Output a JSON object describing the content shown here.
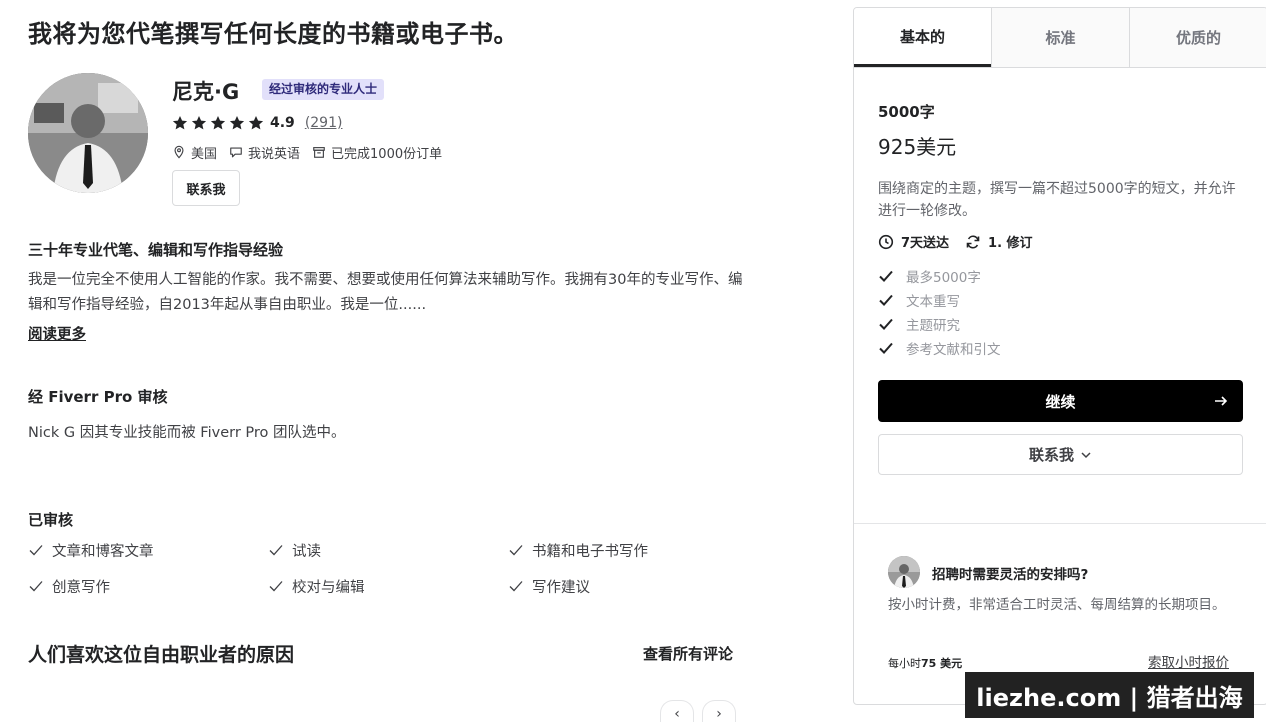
{
  "gig": {
    "title": "我将为您代笔撰写任何长度的书籍或电子书。"
  },
  "seller": {
    "name": "尼克·G",
    "badge": "经过审核的专业人士",
    "rating": "4.9",
    "rating_count": "(291)",
    "stars": 5,
    "location": "美国",
    "language": "我说英语",
    "orders": "已完成1000份订单",
    "contact_label": "联系我"
  },
  "about": {
    "heading": "三十年专业代笔、编辑和写作指导经验",
    "text": "我是一位完全不使用人工智能的作家。我不需要、想要或使用任何算法来辅助写作。我拥有30年的专业写作、编辑和写作指导经验，自2013年起从事自由职业。我是一位......",
    "read_more": "阅读更多"
  },
  "pro": {
    "heading": "经 Fiverr Pro 审核",
    "text": "Nick G 因其专业技能而被 Fiverr Pro 团队选中。"
  },
  "vetted": {
    "heading": "已审核",
    "items": [
      "文章和博客文章",
      "试读",
      "书籍和电子书写作",
      "创意写作",
      "校对与编辑",
      "写作建议"
    ]
  },
  "reviews": {
    "title": "人们喜欢这位自由职业者的原因",
    "see_all": "查看所有评论",
    "prev": "‹",
    "next": "›"
  },
  "package": {
    "tabs": [
      "基本的",
      "标准",
      "优质的"
    ],
    "active_tab": 0,
    "name": "5000字",
    "price": "925美元",
    "description": "围绕商定的主题，撰写一篇不超过5000字的短文，并允许进行一轮修改。",
    "delivery": "7天送达",
    "revisions": "1. 修订",
    "features": [
      "最多5000字",
      "文本重写",
      "主题研究",
      "参考文献和引文"
    ],
    "continue_label": "继续",
    "contact_label": "联系我"
  },
  "hourly": {
    "title": "招聘时需要灵活的安排吗?",
    "description": "按小时计费，非常适合工时灵活、每周结算的长期项目。",
    "rate_prefix": "每小时",
    "rate_value": "75 美元",
    "link": "索取小时报价"
  },
  "watermark": {
    "text": "liezhe.com | 猎者出海"
  }
}
